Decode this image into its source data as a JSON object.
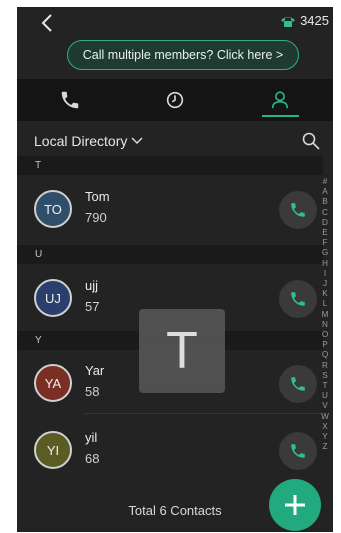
{
  "status": {
    "extension": "3425"
  },
  "banner": {
    "text": "Call multiple members? Click here >"
  },
  "tabs": [
    {
      "icon": "phone-icon"
    },
    {
      "icon": "history-icon"
    },
    {
      "icon": "contacts-icon",
      "active": true
    }
  ],
  "directory": {
    "label": "Local Directory"
  },
  "sections": {
    "t": "T",
    "u": "U",
    "y": "Y"
  },
  "contacts": [
    {
      "initials": "TO",
      "name": "Tom",
      "number": "790",
      "avatar_color": "#2f4e6a"
    },
    {
      "initials": "UJ",
      "name": "ujj",
      "number": "57",
      "avatar_color": "#2b3f6c"
    },
    {
      "initials": "YA",
      "name": "Yar",
      "number": "58",
      "avatar_color": "#7a2f24"
    },
    {
      "initials": "YI",
      "name": "yil",
      "number": "68",
      "avatar_color": "#5a5c24"
    }
  ],
  "index_letters": [
    "#",
    "A",
    "B",
    "C",
    "D",
    "E",
    "F",
    "G",
    "H",
    "I",
    "J",
    "K",
    "L",
    "M",
    "N",
    "O",
    "P",
    "Q",
    "R",
    "S",
    "T",
    "U",
    "V",
    "W",
    "X",
    "Y",
    "Z"
  ],
  "overlay_letter": "T",
  "footer": {
    "total": "Total 6 Contacts"
  },
  "colors": {
    "accent": "#28b48a",
    "call_icon": "#2fc08f",
    "background": "#232323"
  }
}
